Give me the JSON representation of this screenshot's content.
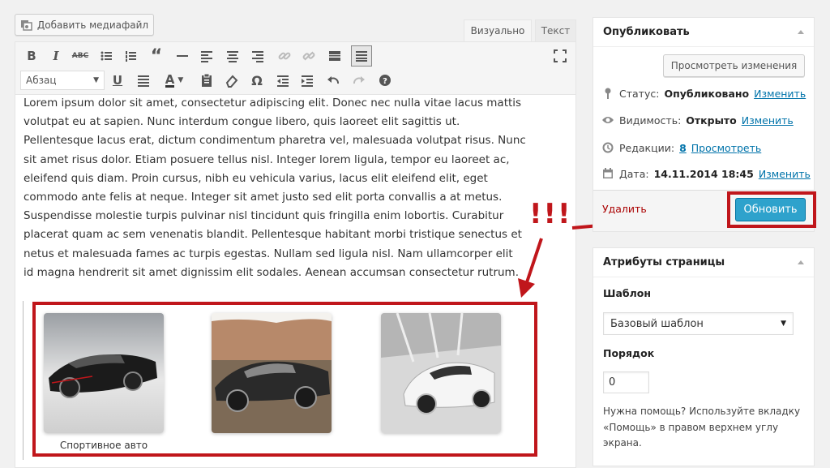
{
  "editor": {
    "add_media_label": "Добавить медиафайл",
    "tabs": {
      "visual": "Визуально",
      "text": "Текст"
    },
    "format_select": "Абзац",
    "toolbar_icons": [
      "bold-icon",
      "italic-icon",
      "strikethrough-icon",
      "bullet-list-icon",
      "numbered-list-icon",
      "blockquote-icon",
      "horizontal-rule-icon",
      "align-left-icon",
      "align-center-icon",
      "align-right-icon",
      "link-icon",
      "unlink-icon",
      "read-more-icon",
      "toolbar-toggle-icon",
      "fullscreen-icon",
      "underline-icon",
      "justify-icon",
      "text-color-icon",
      "paste-text-icon",
      "clear-format-icon",
      "special-char-icon",
      "outdent-icon",
      "indent-icon",
      "undo-icon",
      "redo-icon",
      "help-icon"
    ],
    "content": "Lorem ipsum dolor sit amet, consectetur adipiscing elit. Donec nec nulla vitae lacus mattis volutpat eu at sapien. Nunc interdum congue libero, quis laoreet elit sagittis ut. Pellentesque lacus erat, dictum condimentum pharetra vel, malesuada volutpat risus. Nunc sit amet risus dolor. Etiam posuere tellus nisl. Integer lorem ligula, tempor eu laoreet ac, eleifend quis diam. Proin cursus, nibh eu vehicula varius, lacus elit eleifend elit, eget commodo ante felis at neque. Integer sit amet justo sed elit porta convallis a at metus. Suspendisse molestie turpis pulvinar nisl tincidunt quis fringilla enim lobortis. Curabitur placerat quam ac sem venenatis blandit. Pellentesque habitant morbi tristique senectus et netus et malesuada fames ac turpis egestas. Nullam sed ligula nisl. Nam ullamcorper elit id magna hendrerit sit amet dignissim elit sodales. Aenean accumsan consectetur rutrum.",
    "gallery_caption": "Спортивное авто",
    "annotation": "!!!"
  },
  "publish": {
    "title": "Опубликовать",
    "preview_label": "Просмотреть изменения",
    "status_label": "Статус:",
    "status_value": "Опубликовано",
    "status_link": "Изменить",
    "visibility_label": "Видимость:",
    "visibility_value": "Открыто",
    "visibility_link": "Изменить",
    "revisions_label": "Редакции:",
    "revisions_value": "8",
    "revisions_link": "Просмотреть",
    "date_label": "Дата:",
    "date_value": "14.11.2014 18:45",
    "date_link": "Изменить",
    "delete_label": "Удалить",
    "update_label": "Обновить"
  },
  "attributes": {
    "title": "Атрибуты страницы",
    "template_label": "Шаблон",
    "template_value": "Базовый шаблон",
    "order_label": "Порядок",
    "order_value": "0",
    "help_text": "Нужна помощь? Используйте вкладку «Помощь» в правом верхнем углу экрана."
  },
  "colors": {
    "accent": "#2ea2cc",
    "highlight": "#c0161b",
    "link": "#0073aa"
  }
}
